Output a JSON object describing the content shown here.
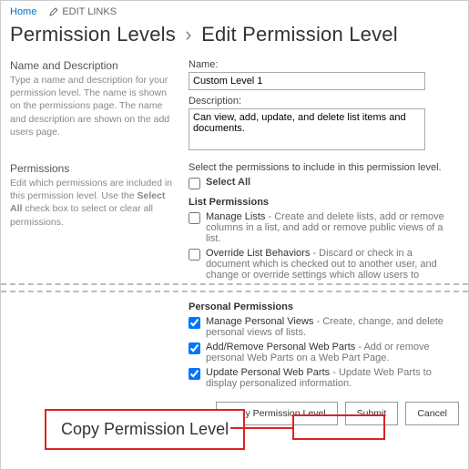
{
  "nav": {
    "home": "Home",
    "editlinks": "EDIT LINKS"
  },
  "title": {
    "crumb": "Permission Levels",
    "sep": "›",
    "page": "Edit Permission Level"
  },
  "sections": {
    "namedesc": {
      "title": "Name and Description",
      "desc": "Type a name and description for your permission level.  The name is shown on the permissions page.  The name and description are shown on the add users page.",
      "name_label": "Name:",
      "name_value": "Custom Level 1",
      "desc_label": "Description:",
      "desc_value": "Can view, add, update, and delete list items and documents."
    },
    "perms": {
      "title": "Permissions",
      "desc_pre": "Edit which permissions are included in this permission level. Use the ",
      "desc_bold": "Select All",
      "desc_post": " check box to select or clear all permissions.",
      "intro": "Select the permissions to include in this permission level.",
      "selectall": "Select All",
      "listperms_head": "List Permissions",
      "listperms": [
        {
          "name": "Manage Lists",
          "desc": "Create and delete lists, add or remove columns in a list, and add or remove public views of a list.",
          "checked": false
        },
        {
          "name": "Override List Behaviors",
          "desc": "Discard or check in a document which is checked out to another user, and change or override settings which allow users to",
          "checked": false
        }
      ],
      "personalperms_head": "Personal Permissions",
      "personalperms": [
        {
          "name": "Manage Personal Views",
          "desc": "Create, change, and delete personal views of lists.",
          "checked": true
        },
        {
          "name": "Add/Remove Personal Web Parts",
          "desc": "Add or remove personal Web Parts on a Web Part Page.",
          "checked": true
        },
        {
          "name": "Update Personal Web Parts",
          "desc": "Update Web Parts to display personalized information.",
          "checked": true
        }
      ]
    }
  },
  "buttons": {
    "copy": "Copy Permission Level",
    "submit": "Submit",
    "cancel": "Cancel"
  },
  "callout": {
    "text": "Copy Permission Level"
  }
}
